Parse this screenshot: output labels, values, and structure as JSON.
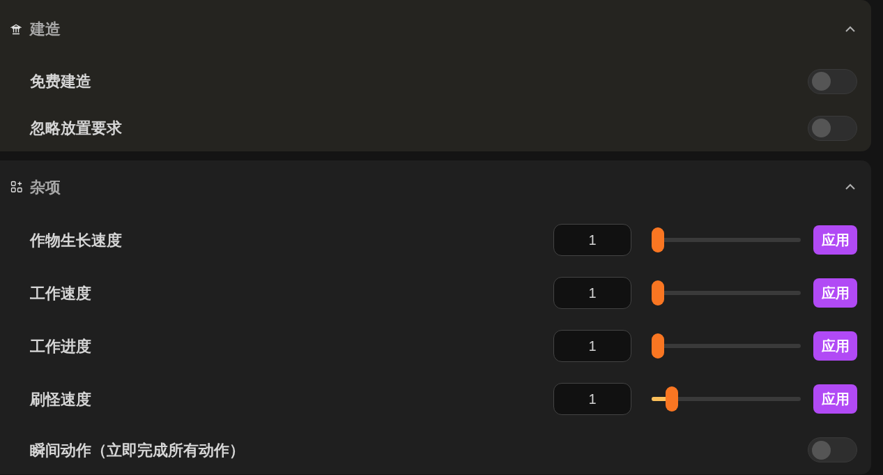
{
  "sections": [
    {
      "title": "建造",
      "expanded": true,
      "rows": [
        {
          "kind": "toggle",
          "label": "免费建造",
          "on": false
        },
        {
          "kind": "toggle",
          "label": "忽略放置要求",
          "on": false
        }
      ]
    },
    {
      "title": "杂项",
      "expanded": true,
      "rows": [
        {
          "kind": "slider",
          "label": "作物生长速度",
          "value": "1",
          "level": 0,
          "button": "应用"
        },
        {
          "kind": "slider",
          "label": "工作速度",
          "value": "1",
          "level": 0,
          "button": "应用"
        },
        {
          "kind": "slider",
          "label": "工作进度",
          "value": "1",
          "level": 0,
          "button": "应用"
        },
        {
          "kind": "slider",
          "label": "刷怪速度",
          "value": "1",
          "level": 0.1,
          "button": "应用"
        },
        {
          "kind": "toggle",
          "label": "瞬间动作（立即完成所有动作）",
          "on": false
        }
      ]
    }
  ]
}
